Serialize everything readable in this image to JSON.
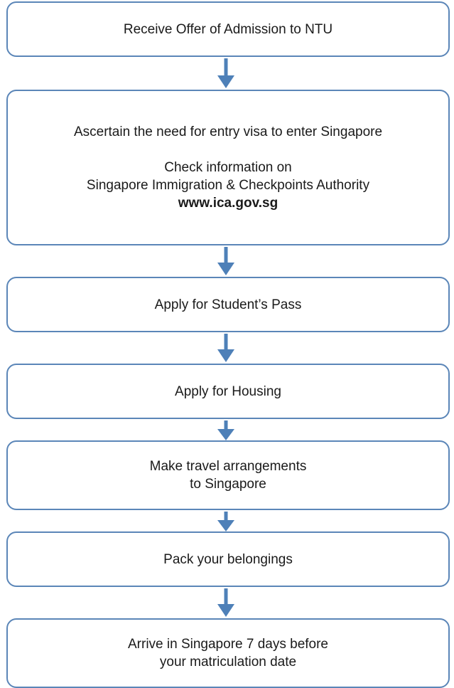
{
  "flowchart": {
    "steps": [
      {
        "lines": [
          "Receive Offer of Admission to NTU"
        ]
      },
      {
        "lines": [
          "Ascertain the need for entry visa to enter Singapore"
        ],
        "sub_lines": [
          "Check information on",
          "Singapore Immigration & Checkpoints Authority"
        ],
        "link": "www.ica.gov.sg"
      },
      {
        "lines": [
          "Apply for Student’s Pass"
        ]
      },
      {
        "lines": [
          "Apply for Housing"
        ]
      },
      {
        "lines": [
          "Make travel arrangements",
          "to Singapore"
        ]
      },
      {
        "lines": [
          "Pack your belongings"
        ]
      },
      {
        "lines": [
          "Arrive in Singapore 7 days before",
          "your matriculation date"
        ]
      }
    ],
    "colors": {
      "box_border": "#5b86b8",
      "arrow": "#4e80b8"
    }
  }
}
